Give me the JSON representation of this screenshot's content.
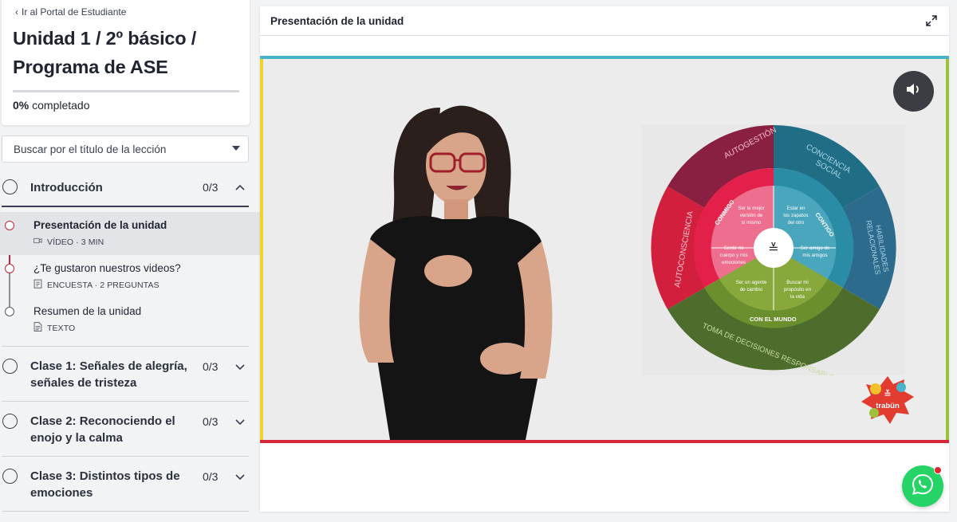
{
  "sidebar": {
    "back_link": "Ir al Portal de Estudiante",
    "course_title": "Unidad 1 / 2º básico / Programa de ASE",
    "progress_percent": "0%",
    "progress_value": 0,
    "progress_label": "completado",
    "search_placeholder": "Buscar por el título de la lección",
    "sections": [
      {
        "title": "Introducción",
        "count": "0/3",
        "expanded": true,
        "lessons": [
          {
            "title": "Presentación de la unidad",
            "meta": "VÍDEO · 3 MIN",
            "icon": "video-icon",
            "active": true
          },
          {
            "title": "¿Te gustaron nuestros videos?",
            "meta": "ENCUESTA · 2 PREGUNTAS",
            "icon": "survey-icon",
            "active": false
          },
          {
            "title": "Resumen de la unidad",
            "meta": "TEXTO",
            "icon": "text-icon",
            "active": false
          }
        ]
      },
      {
        "title": "Clase 1: Señales de alegría, señales de tristeza",
        "count": "0/3",
        "expanded": false
      },
      {
        "title": "Clase 2: Reconociendo el enojo y la calma",
        "count": "0/3",
        "expanded": false
      },
      {
        "title": "Clase 3: Distintos tipos de emociones",
        "count": "0/3",
        "expanded": false
      }
    ]
  },
  "viewer": {
    "title": "Presentación de la unidad",
    "expand_icon": "expand-icon",
    "sound_icon": "speaker-icon"
  },
  "wheel": {
    "outer": [
      "AUTOGESTIÓN",
      "CONCIENCIA SOCIAL",
      "HABILIDADES RELACIONALES",
      "TOMA DE DECISIONES RESPONSABLES",
      "AUTOCONSCIENCIA"
    ],
    "ring": [
      "CONMIGO",
      "CONTIGO",
      "CON EL MUNDO"
    ],
    "inner": [
      "Ser la mejor versión de sí mismo",
      "Estar en los zapatos del otro",
      "Sentir mi cuerpo y mis emociones",
      "Ser amigo de mis amigos",
      "Ser un agente de cambio",
      "Buscar mi propósito en la vida"
    ]
  },
  "brand": "trabün",
  "colors": {
    "accent_dark": "#3a4150",
    "red": "#d4283a",
    "teal": "#4bb3c9",
    "yellow": "#f0d32a",
    "green": "#9dc13a",
    "whatsapp": "#25d366"
  }
}
